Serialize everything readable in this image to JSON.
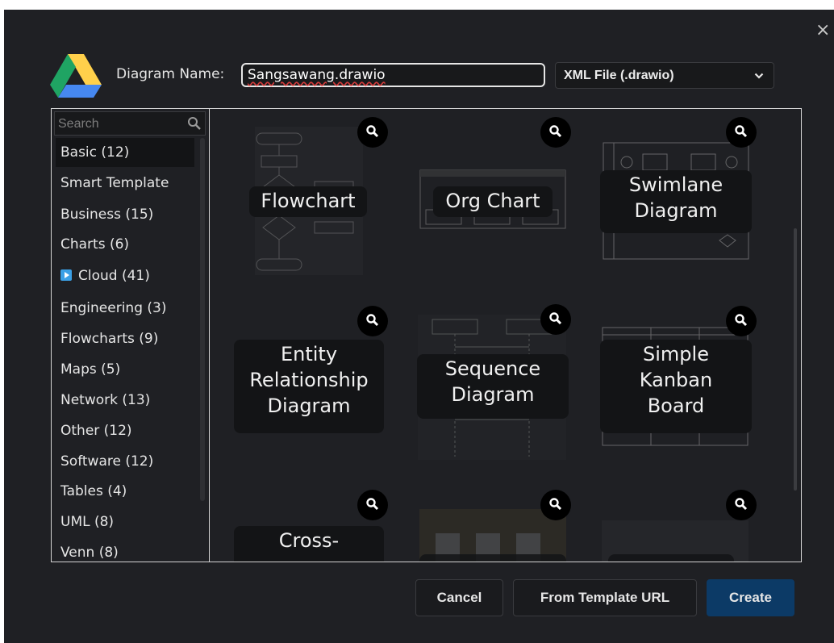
{
  "dialog": {
    "close_glyph": "×",
    "name_label": "Diagram Name:",
    "name_value": "Sangsawang.drawio",
    "format_value": "XML File (.drawio)"
  },
  "sidebar": {
    "search_placeholder": "Search",
    "categories": [
      {
        "label": "Basic (12)",
        "selected": true
      },
      {
        "label": "Smart Template"
      },
      {
        "label": "Business (15)"
      },
      {
        "label": "Charts (6)"
      },
      {
        "label": "Cloud (41)",
        "icon": "cloud-expand-icon"
      },
      {
        "label": "Engineering (3)"
      },
      {
        "label": "Flowcharts (9)"
      },
      {
        "label": "Maps (5)"
      },
      {
        "label": "Network (13)"
      },
      {
        "label": "Other (12)"
      },
      {
        "label": "Software (12)"
      },
      {
        "label": "Tables (4)"
      },
      {
        "label": "UML (8)"
      },
      {
        "label": "Venn (8)"
      }
    ]
  },
  "templates": [
    {
      "label": "Flowchart"
    },
    {
      "label": "Org Chart"
    },
    {
      "label": "Swimlane\nDiagram"
    },
    {
      "label": "Entity\nRelationship\nDiagram"
    },
    {
      "label": "Sequence\nDiagram"
    },
    {
      "label": "Simple\nKanban\nBoard"
    },
    {
      "label": "Cross-"
    },
    {
      "label": ""
    },
    {
      "label": ""
    }
  ],
  "buttons": {
    "cancel": "Cancel",
    "from_template_url": "From Template URL",
    "create": "Create"
  },
  "colors": {
    "dialog_bg": "#1f2024",
    "primary_button": "#0c3a66",
    "drive_green": "#1fa463",
    "drive_yellow": "#ffd04b",
    "drive_blue": "#4688f1"
  }
}
